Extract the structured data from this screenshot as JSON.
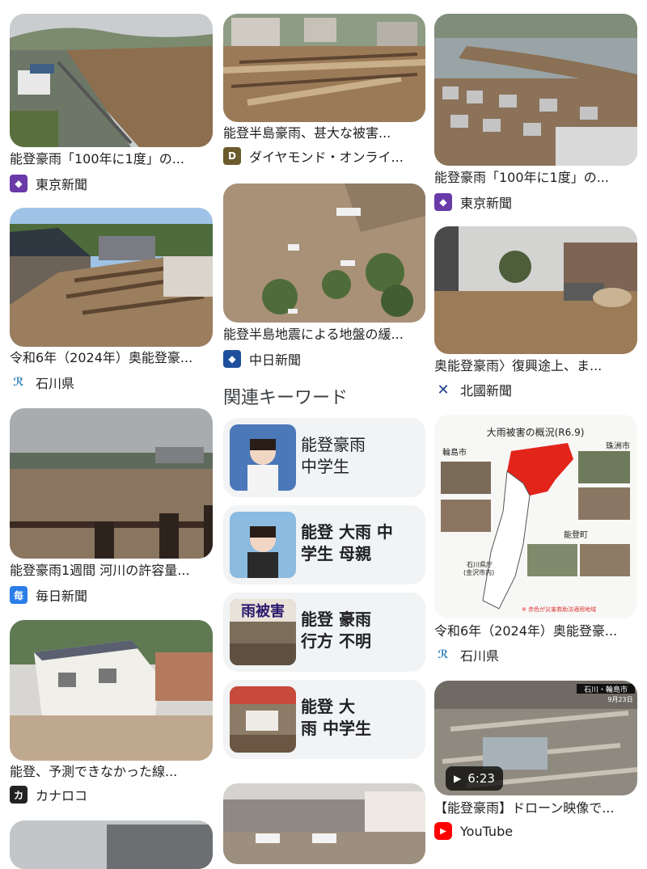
{
  "column1": [
    {
      "title": "能登豪雨「100年に1度」の...",
      "source": "東京新聞",
      "source_icon": "tokyo-shimbun-icon",
      "icon_color": "#6a3aa8"
    },
    {
      "title": "令和6年（2024年）奥能登豪...",
      "source": "石川県",
      "source_icon": "ishikawa-prefecture-icon",
      "icon_color": "#2e7fb8"
    },
    {
      "title": "能登豪雨1週間 河川の許容量...",
      "source": "毎日新聞",
      "source_icon": "mainichi-icon",
      "icon_color": "#2b7de9"
    },
    {
      "title": "能登、予測できなかった線...",
      "source": "カナロコ",
      "source_icon": "kanaloco-icon",
      "icon_color": "#222222"
    }
  ],
  "column2": [
    {
      "title": "能登半島豪雨、甚大な被害...",
      "source": "ダイヤモンド・オンライ...",
      "source_icon": "diamond-online-icon",
      "icon_color": "#6b5a2c"
    },
    {
      "title": "能登半島地震による地盤の緩...",
      "source": "中日新聞",
      "source_icon": "chunichi-icon",
      "icon_color": "#1e4f9c"
    }
  ],
  "column3": [
    {
      "title": "能登豪雨「100年に1度」の...",
      "source": "東京新聞",
      "source_icon": "tokyo-shimbun-icon",
      "icon_color": "#6a3aa8"
    },
    {
      "title": "奥能登豪雨〉復興途上、ま...",
      "source": "北國新聞",
      "source_icon": "hokkoku-icon",
      "icon_color": "#1e3f8c"
    },
    {
      "title": "令和6年（2024年）奥能登豪...",
      "source": "石川県",
      "source_icon": "ishikawa-prefecture-icon",
      "icon_color": "#2e7fb8"
    },
    {
      "title": "【能登豪雨】ドローン映像で...",
      "source": "YouTube",
      "source_icon": "youtube-icon",
      "icon_color": "#ff0000",
      "duration": "6:23"
    }
  ],
  "map_image": {
    "title": "大雨被害の概況(R6.9)",
    "labels": [
      "輪島市",
      "珠洲市",
      "能登町",
      "石川県庁",
      "(金沢市内)"
    ],
    "note": "※ 赤色が災害救助法適用地域"
  },
  "video_overlay": {
    "place": "石川・輪島市",
    "date": "9月23日"
  },
  "keywords": {
    "heading": "関連キーワード",
    "items": [
      {
        "line1": "能登豪雨",
        "line2": "中学生"
      },
      {
        "line1": "能登 大雨 中",
        "line2": "学生 母親"
      },
      {
        "line1": "能登 豪雨",
        "line2": "行方 不明",
        "image_text": "雨被害"
      },
      {
        "line1": "能登 大",
        "line2": "雨 中学生"
      }
    ]
  }
}
